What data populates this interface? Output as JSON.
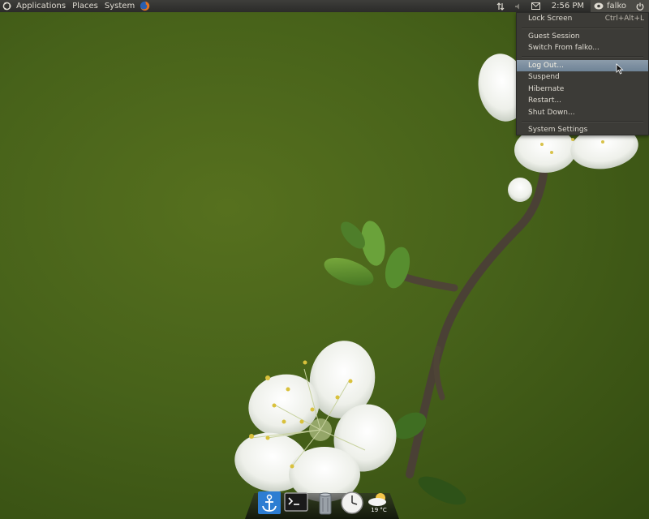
{
  "panel": {
    "applications": "Applications",
    "places": "Places",
    "system": "System",
    "clock": "2:56 PM",
    "user": "falko"
  },
  "session_menu": {
    "lock_screen": "Lock Screen",
    "lock_shortcut": "Ctrl+Alt+L",
    "guest_session": "Guest Session",
    "switch_from": "Switch From falko...",
    "log_out": "Log Out...",
    "suspend": "Suspend",
    "hibernate": "Hibernate",
    "restart": "Restart...",
    "shut_down": "Shut Down...",
    "system_settings": "System Settings"
  },
  "dock": {
    "weather_temp": "19 °C"
  },
  "icons": {
    "logo": "ubuntu-logo-icon",
    "browser": "firefox-icon",
    "network": "network-arrows-icon",
    "sound": "speaker-icon",
    "mail": "envelope-icon",
    "presence": "user-presence-icon",
    "power": "power-icon"
  },
  "colors": {
    "panel": "#2b2b29",
    "menu_bg": "#3c3b37",
    "highlight": "#7d8fa1",
    "wallpaper": "#47621a"
  }
}
